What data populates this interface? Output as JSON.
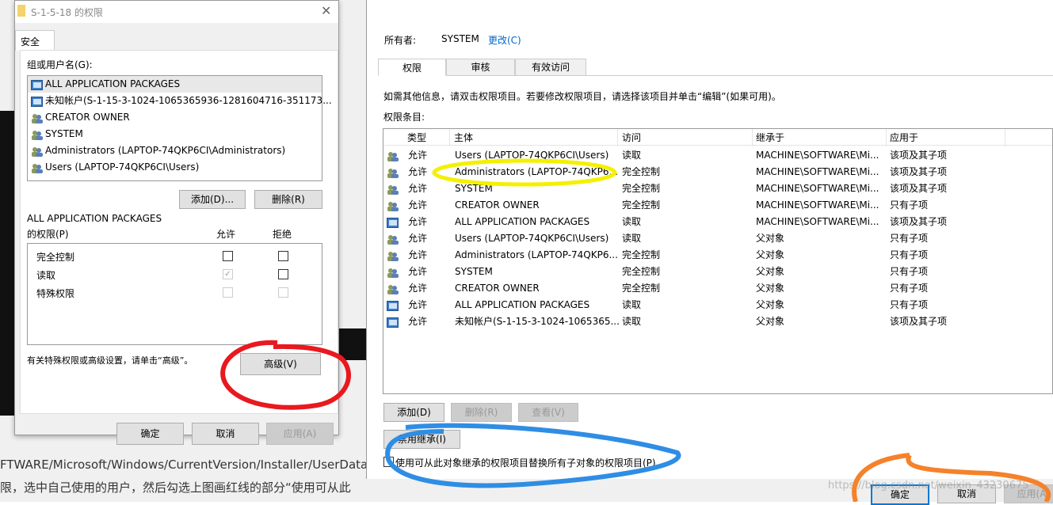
{
  "background": {
    "line1": "FTWARE/Microsoft/Windows/CurrentVersion/Installer/UserData/S",
    "line2": "限，选中自己使用的用户，然后勾选上图画红线的部分“使用可从此",
    "watermark": "https://blog.csdn.net/weixin_43230675"
  },
  "left_dialog": {
    "title": "S-1-5-18 的权限",
    "close": "✕",
    "tab": "安全",
    "group_label": "组或用户名(G):",
    "users": [
      {
        "name": "ALL APPLICATION PACKAGES",
        "icon": "app-packages-icon"
      },
      {
        "name": "未知帐户(S-1-15-3-1024-1065365936-1281604716-351173...",
        "icon": "unknown-account-icon"
      },
      {
        "name": "CREATOR OWNER",
        "icon": "group-icon"
      },
      {
        "name": "SYSTEM",
        "icon": "group-icon"
      },
      {
        "name": "Administrators (LAPTOP-74QKP6CI\\Administrators)",
        "icon": "group-icon"
      },
      {
        "name": "Users (LAPTOP-74QKP6CI\\Users)",
        "icon": "group-icon"
      }
    ],
    "add": "添加(D)...",
    "remove": "删除(R)",
    "perm_for": "ALL APPLICATION PACKAGES",
    "perm_label": "的权限(P)",
    "allow": "允许",
    "deny": "拒绝",
    "permissions": [
      {
        "name": "完全控制",
        "allow": false,
        "deny": false
      },
      {
        "name": "读取",
        "allow": true,
        "deny": false
      },
      {
        "name": "特殊权限",
        "allow": false,
        "deny": false
      }
    ],
    "advanced_hint": "有关特殊权限或高级设置，请单击“高级”。",
    "advanced": "高级(V)",
    "ok": "确定",
    "cancel": "取消",
    "apply": "应用(A)"
  },
  "right_window": {
    "owner_label": "所有者:",
    "owner": "SYSTEM",
    "change": "更改(C)",
    "tabs": [
      "权限",
      "审核",
      "有效访问"
    ],
    "info": "如需其他信息，请双击权限项目。若要修改权限项目，请选择该项目并单击“编辑”(如果可用)。",
    "entries_label": "权限条目:",
    "columns": [
      "类型",
      "主体",
      "访问",
      "继承于",
      "应用于"
    ],
    "rows": [
      {
        "icon": "group-icon",
        "type": "允许",
        "principal": "Users (LAPTOP-74QKP6CI\\Users)",
        "access": "读取",
        "inherited": "MACHINE\\SOFTWARE\\Mi...",
        "applies": "该项及其子项"
      },
      {
        "icon": "group-icon",
        "type": "允许",
        "principal": "Administrators (LAPTOP-74QKP6...",
        "access": "完全控制",
        "inherited": "MACHINE\\SOFTWARE\\Mi...",
        "applies": "该项及其子项"
      },
      {
        "icon": "group-icon",
        "type": "允许",
        "principal": "SYSTEM",
        "access": "完全控制",
        "inherited": "MACHINE\\SOFTWARE\\Mi...",
        "applies": "该项及其子项"
      },
      {
        "icon": "group-icon",
        "type": "允许",
        "principal": "CREATOR OWNER",
        "access": "完全控制",
        "inherited": "MACHINE\\SOFTWARE\\Mi...",
        "applies": "只有子项"
      },
      {
        "icon": "app-packages-icon",
        "type": "允许",
        "principal": "ALL APPLICATION PACKAGES",
        "access": "读取",
        "inherited": "MACHINE\\SOFTWARE\\Mi...",
        "applies": "该项及其子项"
      },
      {
        "icon": "group-icon",
        "type": "允许",
        "principal": "Users (LAPTOP-74QKP6CI\\Users)",
        "access": "读取",
        "inherited": "父对象",
        "applies": "只有子项"
      },
      {
        "icon": "group-icon",
        "type": "允许",
        "principal": "Administrators (LAPTOP-74QKP6...",
        "access": "完全控制",
        "inherited": "父对象",
        "applies": "只有子项"
      },
      {
        "icon": "group-icon",
        "type": "允许",
        "principal": "SYSTEM",
        "access": "完全控制",
        "inherited": "父对象",
        "applies": "只有子项"
      },
      {
        "icon": "group-icon",
        "type": "允许",
        "principal": "CREATOR OWNER",
        "access": "完全控制",
        "inherited": "父对象",
        "applies": "只有子项"
      },
      {
        "icon": "app-packages-icon",
        "type": "允许",
        "principal": "ALL APPLICATION PACKAGES",
        "access": "读取",
        "inherited": "父对象",
        "applies": "只有子项"
      },
      {
        "icon": "unknown-account-icon",
        "type": "允许",
        "principal": "未知帐户(S-1-15-3-1024-1065365...",
        "access": "读取",
        "inherited": "父对象",
        "applies": "该项及其子项"
      }
    ],
    "add": "添加(D)",
    "remove": "删除(R)",
    "view": "查看(V)",
    "disable_inheritance": "禁用继承(I)",
    "replace_label": "使用可从此对象继承的权限项目替换所有子对象的权限项目(P)",
    "ok": "确定",
    "cancel": "取消",
    "apply": "应用(A"
  },
  "colors": {
    "red_mark": "#e8191f",
    "yellow_mark": "#f5f000",
    "blue_mark": "#2f8de4",
    "orange_mark": "#f5822a",
    "link": "#0066cc"
  }
}
